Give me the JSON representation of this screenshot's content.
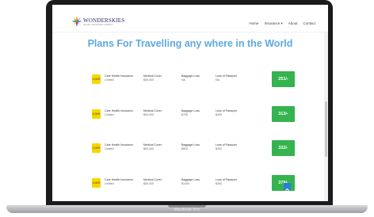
{
  "device": {
    "model_label": "MacBook Pro"
  },
  "brand": {
    "name": "WONDERSKIES",
    "tagline": "TRAVEL INSURANCE COMPANY"
  },
  "nav": {
    "items": [
      "Home",
      "Insurance ▾",
      "About",
      "Contact"
    ]
  },
  "page": {
    "heading": "Plans For Travelling any where in the World"
  },
  "plans": [
    {
      "logo_text": "care",
      "provider": "Care Health Insurance",
      "provider_sub": "Limited",
      "medical_label": "Medical Cover",
      "medical_value": "$50,000",
      "baggage_label": "Baggage Loss",
      "baggage_value": "NA",
      "passport_label": "Loss of Passport",
      "passport_value": "NA",
      "price": "251/-"
    },
    {
      "logo_text": "care",
      "provider": "Care Health Insurance",
      "provider_sub": "Limited",
      "medical_label": "Medical Cover",
      "medical_value": "$50,000",
      "baggage_label": "Baggage Loss",
      "baggage_value": "$750",
      "passport_label": "Loss of Passport",
      "passport_value": "$300",
      "price": "313/-"
    },
    {
      "logo_text": "care",
      "provider": "Care Health Insurance",
      "provider_sub": "Limited",
      "medical_label": "Medical Cover",
      "medical_value": "$50,000",
      "baggage_label": "Baggage Loss",
      "baggage_value": "$500",
      "passport_label": "Loss of Passport",
      "passport_value": "$300",
      "price": "332/-"
    },
    {
      "logo_text": "care",
      "provider": "Care Health Insurance",
      "provider_sub": "Limited",
      "medical_label": "Medical Cover",
      "medical_value": "$50,000",
      "baggage_label": "Baggage Loss",
      "baggage_value": "$1000",
      "passport_label": "Loss of Passport",
      "passport_value": "$300",
      "price": "379/-"
    }
  ],
  "colors": {
    "accent": "#5fa8e0",
    "price": "#35b34f",
    "logo": "#f4d800",
    "back_to_top": "#2d7fd6"
  },
  "icons": [
    "wonderskies-logo-icon",
    "care-logo-icon",
    "arrow-up-icon"
  ]
}
